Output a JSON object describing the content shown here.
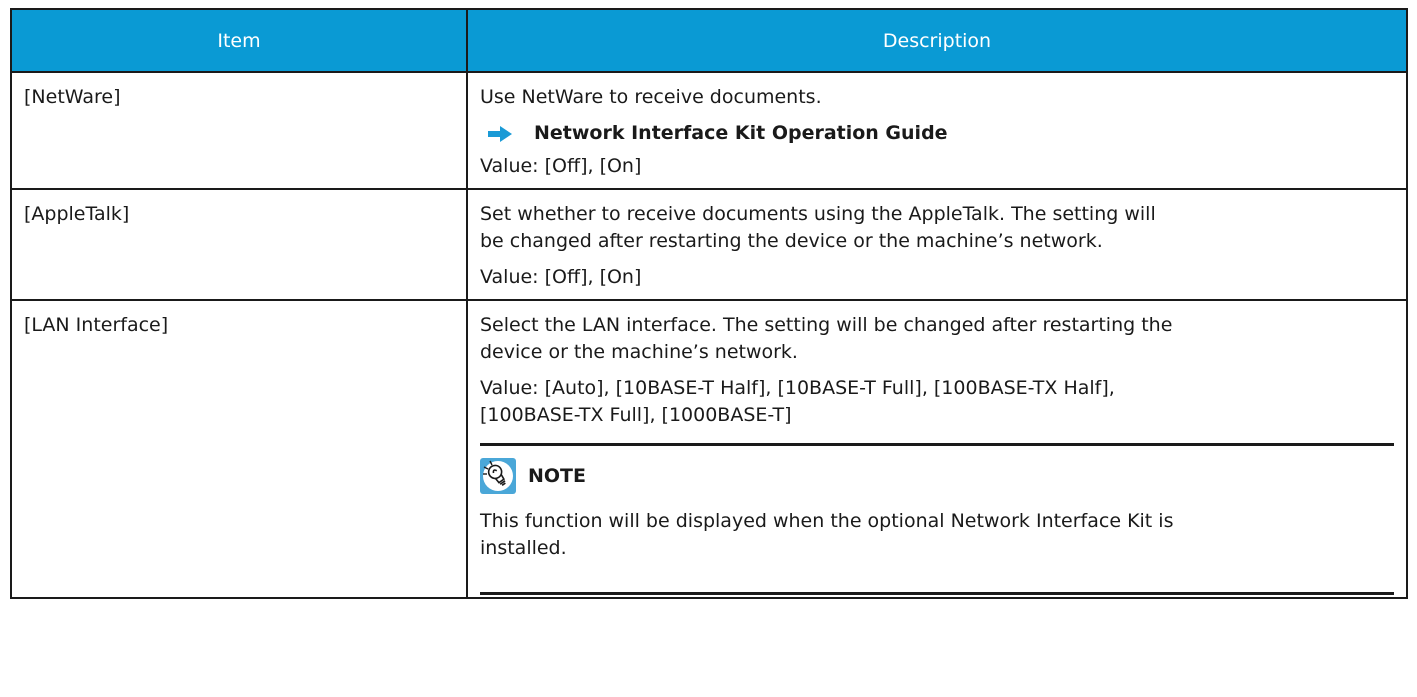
{
  "table": {
    "headers": {
      "item": "Item",
      "description": "Description"
    },
    "rows": [
      {
        "item": "[NetWare]",
        "text": "Use NetWare to receive documents.",
        "reference": "Network Interface Kit Operation Guide",
        "value": "Value: [Off], [On]"
      },
      {
        "item": "[AppleTalk]",
        "text_line1": "Set whether to receive documents using the AppleTalk. The setting will",
        "text_line2": "be changed after restarting the device or the machine’s network.",
        "value": "Value: [Off], [On]"
      },
      {
        "item": "[LAN Interface]",
        "text_line1": "Select the LAN interface. The setting will be changed after restarting the",
        "text_line2": "device or the machine’s network.",
        "value_line1": "Value: [Auto], [10BASE-T Half], [10BASE-T Full], [100BASE-TX Half],",
        "value_line2": "[100BASE-TX Full], [1000BASE-T]",
        "note": {
          "title": "NOTE",
          "line1": "This function will be displayed when the optional Network Interface Kit is",
          "line2": "installed."
        }
      }
    ]
  },
  "colors": {
    "header_bg": "#0a9ad4",
    "header_text": "#ffffff",
    "arrow": "#1a9ad6",
    "border": "#1a1a1a"
  },
  "icons": {
    "reference": "right-arrow-icon",
    "note": "lightbulb-note-icon"
  }
}
